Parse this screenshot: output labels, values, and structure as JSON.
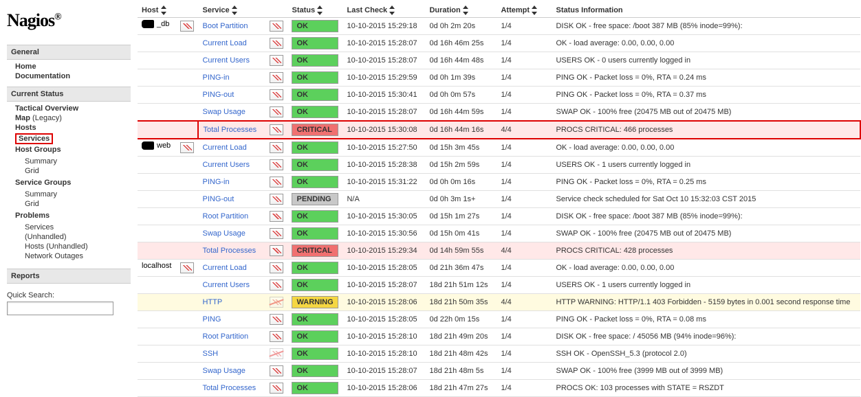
{
  "logo": "Nagios",
  "sidebar": {
    "sections": [
      {
        "title": "General",
        "items": [
          {
            "label": "Home"
          },
          {
            "label": "Documentation"
          }
        ]
      },
      {
        "title": "Current Status",
        "items": [
          {
            "label": "Tactical Overview"
          },
          {
            "label": "Map",
            "suffix": "(Legacy)"
          },
          {
            "label": "Hosts"
          },
          {
            "label": "Services",
            "selected": true
          },
          {
            "label": "Host Groups",
            "sub": [
              {
                "label": "Summary"
              },
              {
                "label": "Grid"
              }
            ]
          },
          {
            "label": "Service Groups",
            "sub": [
              {
                "label": "Summary"
              },
              {
                "label": "Grid"
              }
            ]
          },
          {
            "label": "Problems",
            "sub": [
              {
                "label": "Services"
              },
              {
                "label": "(Unhandled)"
              },
              {
                "label": "Hosts (Unhandled)"
              },
              {
                "label": "Network Outages"
              }
            ]
          }
        ]
      },
      {
        "title": "Reports",
        "items": []
      }
    ],
    "search_label": "Quick Search:"
  },
  "table": {
    "headers": {
      "host": "Host",
      "service": "Service",
      "status": "Status",
      "last_check": "Last Check",
      "duration": "Duration",
      "attempt": "Attempt",
      "status_info": "Status Information"
    },
    "hosts": [
      {
        "name": "_db",
        "services": [
          {
            "name": "Boot Partition",
            "status": "OK",
            "last_check": "10-10-2015 15:29:18",
            "duration": "0d 0h 2m 20s",
            "attempt": "1/4",
            "info": "DISK OK - free space: /boot 387 MB (85% inode=99%):"
          },
          {
            "name": "Current Load",
            "status": "OK",
            "last_check": "10-10-2015 15:28:07",
            "duration": "0d 16h 46m 25s",
            "attempt": "1/4",
            "info": "OK - load average: 0.00, 0.00, 0.00"
          },
          {
            "name": "Current Users",
            "status": "OK",
            "last_check": "10-10-2015 15:28:07",
            "duration": "0d 16h 44m 48s",
            "attempt": "1/4",
            "info": "USERS OK - 0 users currently logged in"
          },
          {
            "name": "PING-in",
            "status": "OK",
            "last_check": "10-10-2015 15:29:59",
            "duration": "0d 0h 1m 39s",
            "attempt": "1/4",
            "info": "PING OK - Packet loss = 0%, RTA = 0.24 ms"
          },
          {
            "name": "PING-out",
            "status": "OK",
            "last_check": "10-10-2015 15:30:41",
            "duration": "0d 0h 0m 57s",
            "attempt": "1/4",
            "info": "PING OK - Packet loss = 0%, RTA = 0.37 ms"
          },
          {
            "name": "Swap Usage",
            "status": "OK",
            "last_check": "10-10-2015 15:28:07",
            "duration": "0d 16h 44m 59s",
            "attempt": "1/4",
            "info": "SWAP OK - 100% free (20475 MB out of 20475 MB)"
          },
          {
            "name": "Total Processes",
            "status": "CRITICAL",
            "last_check": "10-10-2015 15:30:08",
            "duration": "0d 16h 44m 16s",
            "attempt": "4/4",
            "info": "PROCS CRITICAL: 466 processes",
            "highlighted": true
          }
        ]
      },
      {
        "name": "web",
        "services": [
          {
            "name": "Current Load",
            "status": "OK",
            "last_check": "10-10-2015 15:27:50",
            "duration": "0d 15h 3m 45s",
            "attempt": "1/4",
            "info": "OK - load average: 0.00, 0.00, 0.00"
          },
          {
            "name": "Current Users",
            "status": "OK",
            "last_check": "10-10-2015 15:28:38",
            "duration": "0d 15h 2m 59s",
            "attempt": "1/4",
            "info": "USERS OK - 1 users currently logged in"
          },
          {
            "name": "PING-in",
            "status": "OK",
            "last_check": "10-10-2015 15:31:22",
            "duration": "0d 0h 0m 16s",
            "attempt": "1/4",
            "info": "PING OK - Packet loss = 0%, RTA = 0.25 ms"
          },
          {
            "name": "PING-out",
            "status": "PENDING",
            "last_check": "N/A",
            "duration": "0d 0h 3m 1s+",
            "attempt": "1/4",
            "info": "Service check scheduled for Sat Oct 10 15:32:03 CST 2015"
          },
          {
            "name": "Root Partition",
            "status": "OK",
            "last_check": "10-10-2015 15:30:05",
            "duration": "0d 15h 1m 27s",
            "attempt": "1/4",
            "info": "DISK OK - free space: /boot 387 MB (85% inode=99%):"
          },
          {
            "name": "Swap Usage",
            "status": "OK",
            "last_check": "10-10-2015 15:30:56",
            "duration": "0d 15h 0m 41s",
            "attempt": "1/4",
            "info": "SWAP OK - 100% free (20475 MB out of 20475 MB)"
          },
          {
            "name": "Total Processes",
            "status": "CRITICAL",
            "last_check": "10-10-2015 15:29:34",
            "duration": "0d 14h 59m 55s",
            "attempt": "4/4",
            "info": "PROCS CRITICAL: 428 processes"
          }
        ]
      },
      {
        "name": "localhost",
        "services": [
          {
            "name": "Current Load",
            "status": "OK",
            "last_check": "10-10-2015 15:28:05",
            "duration": "0d 21h 36m 47s",
            "attempt": "1/4",
            "info": "OK - load average: 0.00, 0.00, 0.00"
          },
          {
            "name": "Current Users",
            "status": "OK",
            "last_check": "10-10-2015 15:28:07",
            "duration": "18d 21h 51m 12s",
            "attempt": "1/4",
            "info": "USERS OK - 1 users currently logged in"
          },
          {
            "name": "HTTP",
            "status": "WARNING",
            "last_check": "10-10-2015 15:28:06",
            "duration": "18d 21h 50m 35s",
            "attempt": "4/4",
            "info": "HTTP WARNING: HTTP/1.1 403 Forbidden - 5159 bytes in 0.001 second response time",
            "disabled_graph": true
          },
          {
            "name": "PING",
            "status": "OK",
            "last_check": "10-10-2015 15:28:05",
            "duration": "0d 22h 0m 15s",
            "attempt": "1/4",
            "info": "PING OK - Packet loss = 0%, RTA = 0.08 ms"
          },
          {
            "name": "Root Partition",
            "status": "OK",
            "last_check": "10-10-2015 15:28:10",
            "duration": "18d 21h 49m 20s",
            "attempt": "1/4",
            "info": "DISK OK - free space: / 45056 MB (94% inode=96%):"
          },
          {
            "name": "SSH",
            "status": "OK",
            "last_check": "10-10-2015 15:28:10",
            "duration": "18d 21h 48m 42s",
            "attempt": "1/4",
            "info": "SSH OK - OpenSSH_5.3 (protocol 2.0)",
            "disabled_graph": true
          },
          {
            "name": "Swap Usage",
            "status": "OK",
            "last_check": "10-10-2015 15:28:07",
            "duration": "18d 21h 48m 5s",
            "attempt": "1/4",
            "info": "SWAP OK - 100% free (3999 MB out of 3999 MB)"
          },
          {
            "name": "Total Processes",
            "status": "OK",
            "last_check": "10-10-2015 15:28:06",
            "duration": "18d 21h 47m 27s",
            "attempt": "1/4",
            "info": "PROCS OK: 103 processes with STATE = RSZDT"
          }
        ]
      }
    ]
  }
}
